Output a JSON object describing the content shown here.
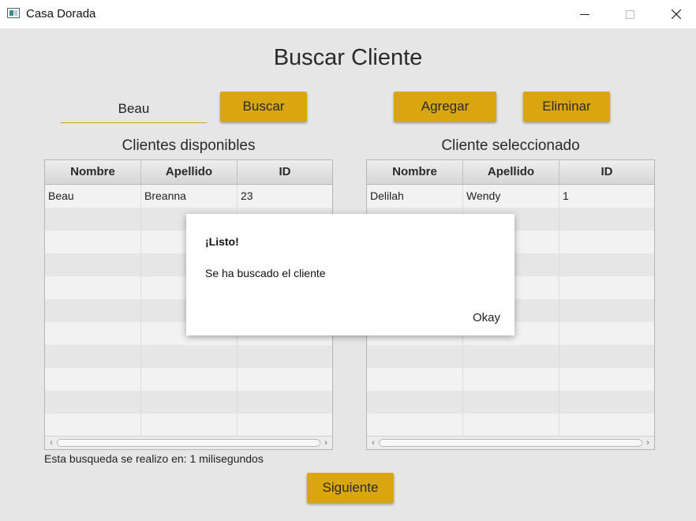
{
  "window": {
    "title": "Casa Dorada"
  },
  "header": {
    "title": "Buscar Cliente"
  },
  "search": {
    "value": "Beau",
    "button_label": "Buscar"
  },
  "actions": {
    "add_label": "Agregar",
    "delete_label": "Eliminar",
    "next_label": "Siguiente"
  },
  "left_table": {
    "heading": "Clientes disponibles",
    "columns": [
      "Nombre",
      "Apellido",
      "ID"
    ],
    "rows": [
      [
        "Beau",
        "Breanna",
        "23"
      ]
    ]
  },
  "right_table": {
    "heading": "Cliente seleccionado",
    "columns": [
      "Nombre",
      "Apellido",
      "ID"
    ],
    "rows": [
      [
        "Delilah",
        "Wendy",
        "1"
      ]
    ]
  },
  "status": {
    "text": "Esta busqueda se realizo en: 1 milisegundos"
  },
  "dialog": {
    "title": "¡Listo!",
    "message": "Se ha buscado el cliente",
    "ok_label": "Okay"
  },
  "colors": {
    "accent": "#d9a60f",
    "background": "#e6e6e6"
  }
}
